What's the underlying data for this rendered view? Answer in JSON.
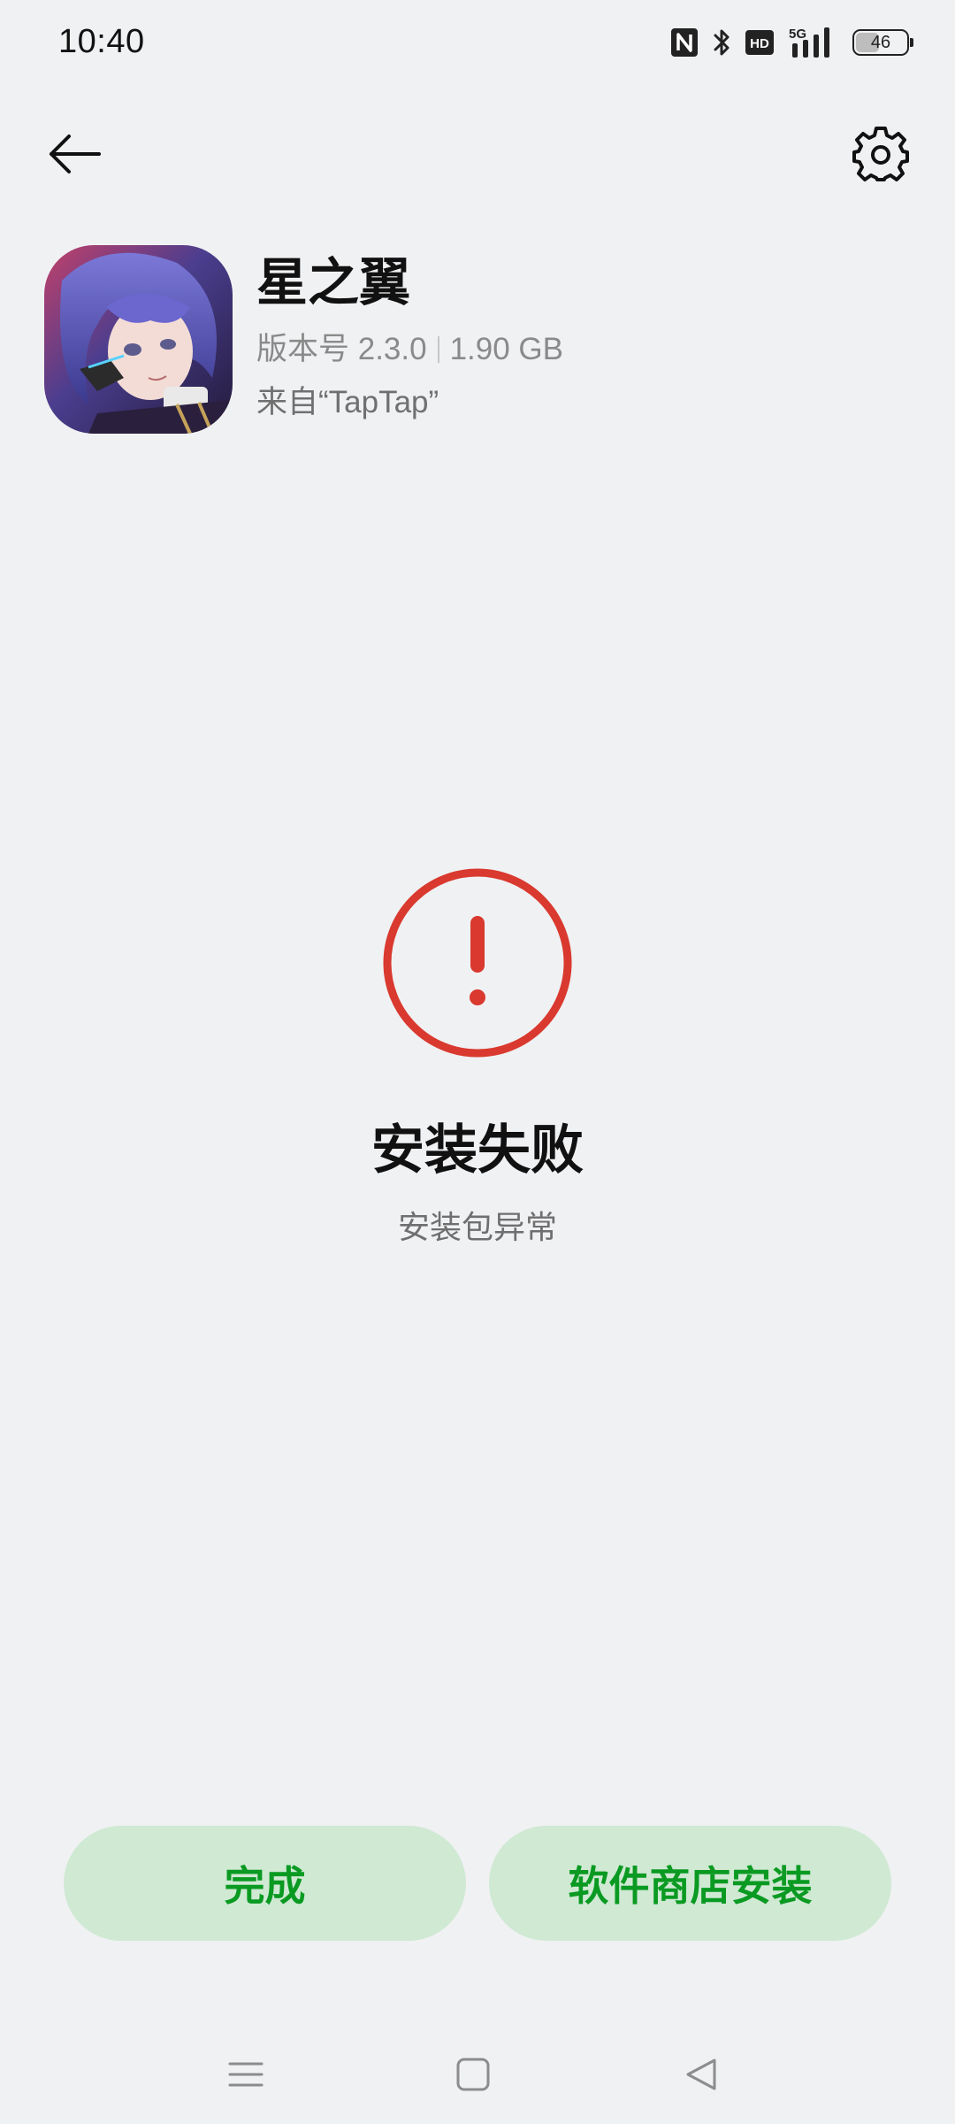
{
  "status_bar": {
    "time": "10:40",
    "battery_level": "46",
    "network": "5G",
    "hd_badge": "HD",
    "icons": [
      "nfc-icon",
      "bluetooth-icon",
      "hd-icon",
      "signal-5g-icon",
      "battery-icon"
    ]
  },
  "toolbar": {
    "back_icon": "arrow-left-icon",
    "settings_icon": "gear-icon"
  },
  "app": {
    "name": "星之翼",
    "version": "版本号 2.3.0",
    "size": "1.90 GB",
    "source": "来自“TapTap”"
  },
  "result": {
    "icon": "exclamation-circle-icon",
    "title": "安装失败",
    "subtitle": "安装包异常"
  },
  "actions": {
    "done_label": "完成",
    "store_install_label": "软件商店安装"
  },
  "navigation": {
    "menu_icon": "menu-icon",
    "home_icon": "home-square-icon",
    "back_icon": "back-triangle-icon"
  },
  "colors": {
    "background": "#f0f1f3",
    "error_red": "#d9392e",
    "button_bg": "#cfe9d3",
    "button_text": "#0a9a22"
  }
}
